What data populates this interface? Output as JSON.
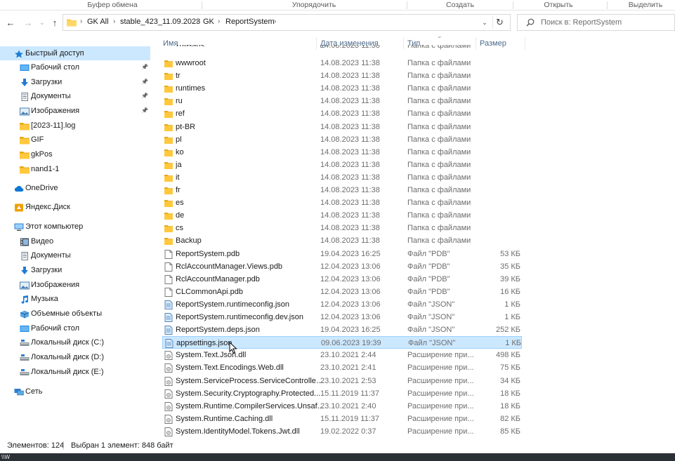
{
  "ribbon": {
    "groups": [
      "Буфер обмена",
      "Упорядочить",
      "Создать",
      "Открыть",
      "Выделить"
    ]
  },
  "nav": {
    "back": "←",
    "forward": "→",
    "recent": "⌄",
    "up": "↑",
    "breadcrumbs": [
      "GK All",
      "stable_423_11.09.2023",
      "GK",
      "ReportSystem"
    ],
    "dropdown": "⌄",
    "refresh": "↻",
    "search_placeholder": "Поиск в: ReportSystem"
  },
  "sidebar": {
    "items": [
      {
        "label": "Быстрый доступ",
        "icon": "star-icon",
        "indent": 0,
        "selected": true,
        "pinned": false
      },
      {
        "label": "Рабочий стол",
        "icon": "desktop-icon",
        "indent": 1,
        "pinned": true
      },
      {
        "label": "Загрузки",
        "icon": "download-icon",
        "indent": 1,
        "pinned": true
      },
      {
        "label": "Документы",
        "icon": "document-icon",
        "indent": 1,
        "pinned": true
      },
      {
        "label": "Изображения",
        "icon": "image-icon",
        "indent": 1,
        "pinned": true
      },
      {
        "label": "[2023-11].log",
        "icon": "folder-icon",
        "indent": 1,
        "pinned": false
      },
      {
        "label": "GIF",
        "icon": "folder-icon",
        "indent": 1,
        "pinned": false
      },
      {
        "label": "gkPos",
        "icon": "folder-icon",
        "indent": 1,
        "pinned": false
      },
      {
        "label": "nand1-1",
        "icon": "folder-icon",
        "indent": 1,
        "pinned": false
      },
      {
        "label": "OneDrive",
        "icon": "cloud-icon",
        "indent": 0,
        "pinned": false
      },
      {
        "label": "Яндекс.Диск",
        "icon": "yandex-disk-icon",
        "indent": 0,
        "pinned": false
      },
      {
        "label": "Этот компьютер",
        "icon": "computer-icon",
        "indent": 0,
        "pinned": false
      },
      {
        "label": "Видео",
        "icon": "video-icon",
        "indent": 1,
        "pinned": false
      },
      {
        "label": "Документы",
        "icon": "document-icon",
        "indent": 1,
        "pinned": false
      },
      {
        "label": "Загрузки",
        "icon": "download-icon",
        "indent": 1,
        "pinned": false
      },
      {
        "label": "Изображения",
        "icon": "image-icon",
        "indent": 1,
        "pinned": false
      },
      {
        "label": "Музыка",
        "icon": "music-icon",
        "indent": 1,
        "pinned": false
      },
      {
        "label": "Объемные объекты",
        "icon": "3d-objects-icon",
        "indent": 1,
        "pinned": false
      },
      {
        "label": "Рабочий стол",
        "icon": "desktop-icon",
        "indent": 1,
        "pinned": false
      },
      {
        "label": "Локальный диск (C:)",
        "icon": "drive-icon",
        "indent": 1,
        "pinned": false
      },
      {
        "label": "Локальный диск (D:)",
        "icon": "drive-icon",
        "indent": 1,
        "pinned": false
      },
      {
        "label": "Локальный диск (E:)",
        "icon": "drive-icon",
        "indent": 1,
        "pinned": false
      },
      {
        "label": "Сеть",
        "icon": "network-icon",
        "indent": 0,
        "pinned": false
      }
    ]
  },
  "list": {
    "columns": [
      "Имя",
      "Дата изменения",
      "Тип",
      "Размер"
    ],
    "partial_row": {
      "name": "zh-Hans",
      "date": "14.08.2023 11:38",
      "type": "Папка с файлами"
    },
    "rows": [
      {
        "name": "wwwroot",
        "date": "14.08.2023 11:38",
        "type": "Папка с файлами",
        "size": "",
        "kind": "folder"
      },
      {
        "name": "tr",
        "date": "14.08.2023 11:38",
        "type": "Папка с файлами",
        "size": "",
        "kind": "folder"
      },
      {
        "name": "runtimes",
        "date": "14.08.2023 11:38",
        "type": "Папка с файлами",
        "size": "",
        "kind": "folder"
      },
      {
        "name": "ru",
        "date": "14.08.2023 11:38",
        "type": "Папка с файлами",
        "size": "",
        "kind": "folder"
      },
      {
        "name": "ref",
        "date": "14.08.2023 11:38",
        "type": "Папка с файлами",
        "size": "",
        "kind": "folder"
      },
      {
        "name": "pt-BR",
        "date": "14.08.2023 11:38",
        "type": "Папка с файлами",
        "size": "",
        "kind": "folder"
      },
      {
        "name": "pl",
        "date": "14.08.2023 11:38",
        "type": "Папка с файлами",
        "size": "",
        "kind": "folder"
      },
      {
        "name": "ko",
        "date": "14.08.2023 11:38",
        "type": "Папка с файлами",
        "size": "",
        "kind": "folder"
      },
      {
        "name": "ja",
        "date": "14.08.2023 11:38",
        "type": "Папка с файлами",
        "size": "",
        "kind": "folder"
      },
      {
        "name": "it",
        "date": "14.08.2023 11:38",
        "type": "Папка с файлами",
        "size": "",
        "kind": "folder"
      },
      {
        "name": "fr",
        "date": "14.08.2023 11:38",
        "type": "Папка с файлами",
        "size": "",
        "kind": "folder"
      },
      {
        "name": "es",
        "date": "14.08.2023 11:38",
        "type": "Папка с файлами",
        "size": "",
        "kind": "folder"
      },
      {
        "name": "de",
        "date": "14.08.2023 11:38",
        "type": "Папка с файлами",
        "size": "",
        "kind": "folder"
      },
      {
        "name": "cs",
        "date": "14.08.2023 11:38",
        "type": "Папка с файлами",
        "size": "",
        "kind": "folder"
      },
      {
        "name": "Backup",
        "date": "14.08.2023 11:38",
        "type": "Папка с файлами",
        "size": "",
        "kind": "folder"
      },
      {
        "name": "ReportSystem.pdb",
        "date": "19.04.2023 16:25",
        "type": "Файл \"PDB\"",
        "size": "53 КБ",
        "kind": "file"
      },
      {
        "name": "RclAccountManager.Views.pdb",
        "date": "12.04.2023 13:06",
        "type": "Файл \"PDB\"",
        "size": "35 КБ",
        "kind": "file"
      },
      {
        "name": "RclAccountManager.pdb",
        "date": "12.04.2023 13:06",
        "type": "Файл \"PDB\"",
        "size": "39 КБ",
        "kind": "file"
      },
      {
        "name": "CLCommonApi.pdb",
        "date": "12.04.2023 13:06",
        "type": "Файл \"PDB\"",
        "size": "16 КБ",
        "kind": "file"
      },
      {
        "name": "ReportSystem.runtimeconfig.json",
        "date": "12.04.2023 13:06",
        "type": "Файл \"JSON\"",
        "size": "1 КБ",
        "kind": "json"
      },
      {
        "name": "ReportSystem.runtimeconfig.dev.json",
        "date": "12.04.2023 13:06",
        "type": "Файл \"JSON\"",
        "size": "1 КБ",
        "kind": "json"
      },
      {
        "name": "ReportSystem.deps.json",
        "date": "19.04.2023 16:25",
        "type": "Файл \"JSON\"",
        "size": "252 КБ",
        "kind": "json"
      },
      {
        "name": "appsettings.json",
        "date": "09.06.2023 19:39",
        "type": "Файл \"JSON\"",
        "size": "1 КБ",
        "kind": "json",
        "selected": true
      },
      {
        "name": "System.Text.Json.dll",
        "date": "23.10.2021 2:44",
        "type": "Расширение при...",
        "size": "498 КБ",
        "kind": "dll"
      },
      {
        "name": "System.Text.Encodings.Web.dll",
        "date": "23.10.2021 2:41",
        "type": "Расширение при...",
        "size": "75 КБ",
        "kind": "dll"
      },
      {
        "name": "System.ServiceProcess.ServiceController...",
        "date": "23.10.2021 2:53",
        "type": "Расширение при...",
        "size": "34 КБ",
        "kind": "dll"
      },
      {
        "name": "System.Security.Cryptography.Protected...",
        "date": "15.11.2019 11:37",
        "type": "Расширение при...",
        "size": "18 КБ",
        "kind": "dll"
      },
      {
        "name": "System.Runtime.CompilerServices.Unsaf...",
        "date": "23.10.2021 2:40",
        "type": "Расширение при...",
        "size": "18 КБ",
        "kind": "dll"
      },
      {
        "name": "System.Runtime.Caching.dll",
        "date": "15.11.2019 11:37",
        "type": "Расширение при...",
        "size": "82 КБ",
        "kind": "dll"
      },
      {
        "name": "System.IdentityModel.Tokens.Jwt.dll",
        "date": "19.02.2022 0:37",
        "type": "Расширение при...",
        "size": "85 КБ",
        "kind": "dll"
      }
    ]
  },
  "status": {
    "count": "Элементов: 124",
    "selection": "Выбран 1 элемент: 848 байт"
  },
  "taskbar": {
    "text": "\\\\W"
  },
  "colors": {
    "selection_bg": "#cce8ff",
    "selection_border": "#99d1ff",
    "folder": "#ffc83d",
    "header_text": "#4d6b8a"
  }
}
